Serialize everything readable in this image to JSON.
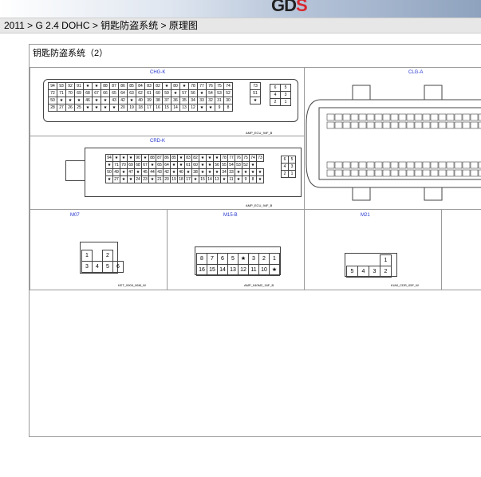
{
  "header": {
    "logo_a": "GD",
    "logo_b": "S",
    "breadcrumb": "2011 > G 2.4 DOHC > 钥匙防盗系统 > 原理图"
  },
  "diagram": {
    "title": "钥匙防盗系统（2）",
    "colors": {
      "label": "#2233cc",
      "border": "#444444"
    },
    "connectors": {
      "chg": {
        "label": "CHG-K",
        "part": "AMP_ECU_94F_B",
        "rows": [
          [
            "94",
            "93",
            "92",
            "91",
            "★",
            "★",
            "88",
            "87",
            "86",
            "85",
            "84",
            "83",
            "82",
            "★",
            "80",
            "★",
            "78",
            "77",
            "76",
            "75",
            "74"
          ],
          [
            "72",
            "71",
            "70",
            "69",
            "68",
            "67",
            "66",
            "65",
            "64",
            "63",
            "62",
            "61",
            "60",
            "59",
            "★",
            "57",
            "56",
            "★",
            "54",
            "53",
            "52"
          ],
          [
            "50",
            "★",
            "★",
            "★",
            "46",
            "★",
            "★",
            "43",
            "42",
            "★",
            "40",
            "39",
            "38",
            "37",
            "36",
            "35",
            "34",
            "33",
            "32",
            "31",
            "30"
          ],
          [
            "28",
            "27",
            "26",
            "25",
            "★",
            "★",
            "★",
            "★",
            "20",
            "19",
            "18",
            "17",
            "16",
            "15",
            "14",
            "13",
            "12",
            "★",
            "★",
            "9",
            "8"
          ]
        ],
        "side_a": [
          "73",
          "51",
          "★",
          ""
        ],
        "side_b": [
          [
            "6",
            "5"
          ],
          [
            "4",
            "3"
          ],
          [
            "2",
            "1"
          ]
        ]
      },
      "crd": {
        "label": "CRD-K",
        "part": "AMP_ECU_94F_B",
        "rows": [
          [
            "94",
            "★",
            "★",
            "★",
            "90",
            "★",
            "88",
            "87",
            "86",
            "85",
            "★",
            "83",
            "82",
            "★",
            "★",
            "★",
            "78",
            "77",
            "76",
            "75",
            "74",
            "73"
          ],
          [
            "★",
            "71",
            "70",
            "69",
            "68",
            "67",
            "★",
            "65",
            "64",
            "★",
            "★",
            "61",
            "60",
            "★",
            "★",
            "56",
            "55",
            "54",
            "53",
            "52",
            "★"
          ],
          [
            "50",
            "49",
            "★",
            "47",
            "★",
            "45",
            "44",
            "43",
            "42",
            "★",
            "40",
            "★",
            "38",
            "★",
            "★",
            "★",
            "34",
            "33",
            "★",
            "★",
            "★",
            "★"
          ],
          [
            "★",
            "27",
            "★",
            "★",
            "24",
            "23",
            "★",
            "21",
            "20",
            "19",
            "18",
            "17",
            "★",
            "15",
            "14",
            "13",
            "★",
            "11",
            "★",
            "9",
            "8",
            "★"
          ]
        ],
        "side": [
          [
            "6",
            "5"
          ],
          [
            "4",
            "3"
          ],
          [
            "2",
            "1"
          ]
        ]
      },
      "clg": {
        "label": "CLG-A"
      },
      "m07": {
        "label": "M07",
        "part": "KET_090II_06M_W",
        "rows": [
          [
            "1",
            "",
            "2"
          ],
          [
            "3",
            "4",
            "5",
            "6"
          ]
        ]
      },
      "m15": {
        "label": "M15-B",
        "part": "AMP_040M2_16F_B",
        "rows": [
          [
            "8",
            "7",
            "6",
            "5",
            "★",
            "3",
            "2",
            "1"
          ],
          [
            "16",
            "15",
            "14",
            "13",
            "12",
            "11",
            "10",
            "★"
          ]
        ]
      },
      "m21": {
        "label": "M21",
        "part": "KUM_CDR_05F_W",
        "rows": [
          [
            "",
            "",
            "",
            "1"
          ],
          [
            "5",
            "4",
            "3",
            "2"
          ]
        ]
      }
    }
  }
}
